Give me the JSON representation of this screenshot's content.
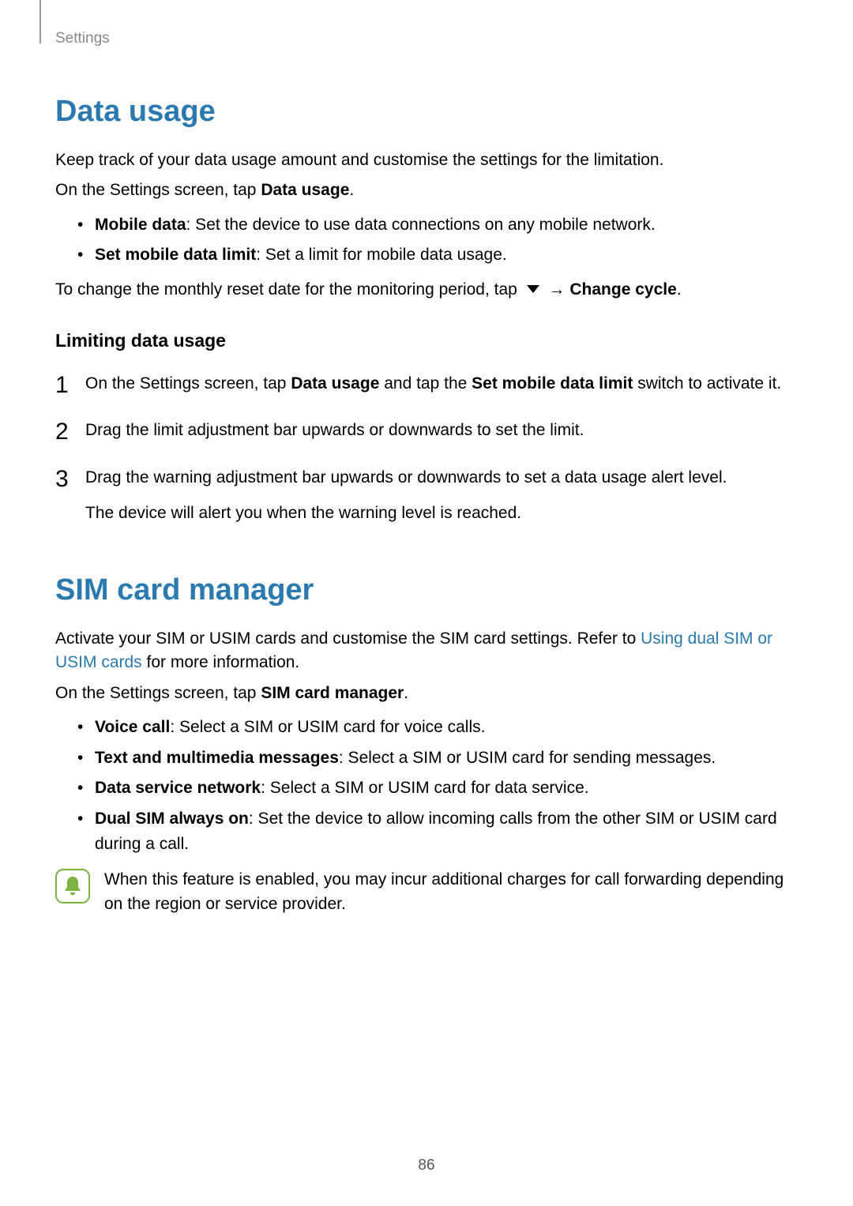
{
  "breadcrumb": "Settings",
  "page_number": "86",
  "data_usage": {
    "title": "Data usage",
    "intro1": "Keep track of your data usage amount and customise the settings for the limitation.",
    "intro2_pre": "On the Settings screen, tap ",
    "intro2_bold": "Data usage",
    "intro2_post": ".",
    "bullets": [
      {
        "bold": "Mobile data",
        "rest": ": Set the device to use data connections on any mobile network."
      },
      {
        "bold": "Set mobile data limit",
        "rest": ": Set a limit for mobile data usage."
      }
    ],
    "change_cycle_pre": "To change the monthly reset date for the monitoring period, tap ",
    "change_cycle_arrow": "→",
    "change_cycle_bold": "Change cycle",
    "change_cycle_post": ".",
    "subsection_title": "Limiting data usage",
    "steps": {
      "s1": {
        "num": "1",
        "pre": "On the Settings screen, tap ",
        "bold1": "Data usage",
        "mid": " and tap the ",
        "bold2": "Set mobile data limit",
        "post": " switch to activate it."
      },
      "s2": {
        "num": "2",
        "text": "Drag the limit adjustment bar upwards or downwards to set the limit."
      },
      "s3": {
        "num": "3",
        "text": "Drag the warning adjustment bar upwards or downwards to set a data usage alert level.",
        "sub": "The device will alert you when the warning level is reached."
      }
    }
  },
  "sim": {
    "title": "SIM card manager",
    "intro_pre": "Activate your SIM or USIM cards and customise the SIM card settings. Refer to ",
    "intro_link": "Using dual SIM or USIM cards",
    "intro_post": " for more information.",
    "line2_pre": "On the Settings screen, tap ",
    "line2_bold": "SIM card manager",
    "line2_post": ".",
    "bullets": [
      {
        "bold": "Voice call",
        "rest": ": Select a SIM or USIM card for voice calls."
      },
      {
        "bold": "Text and multimedia messages",
        "rest": ": Select a SIM or USIM card for sending messages."
      },
      {
        "bold": "Data service network",
        "rest": ": Select a SIM or USIM card for data service."
      },
      {
        "bold": "Dual SIM always on",
        "rest": ": Set the device to allow incoming calls from the other SIM or USIM card during a call."
      }
    ],
    "note": "When this feature is enabled, you may incur additional charges for call forwarding depending on the region or service provider."
  }
}
